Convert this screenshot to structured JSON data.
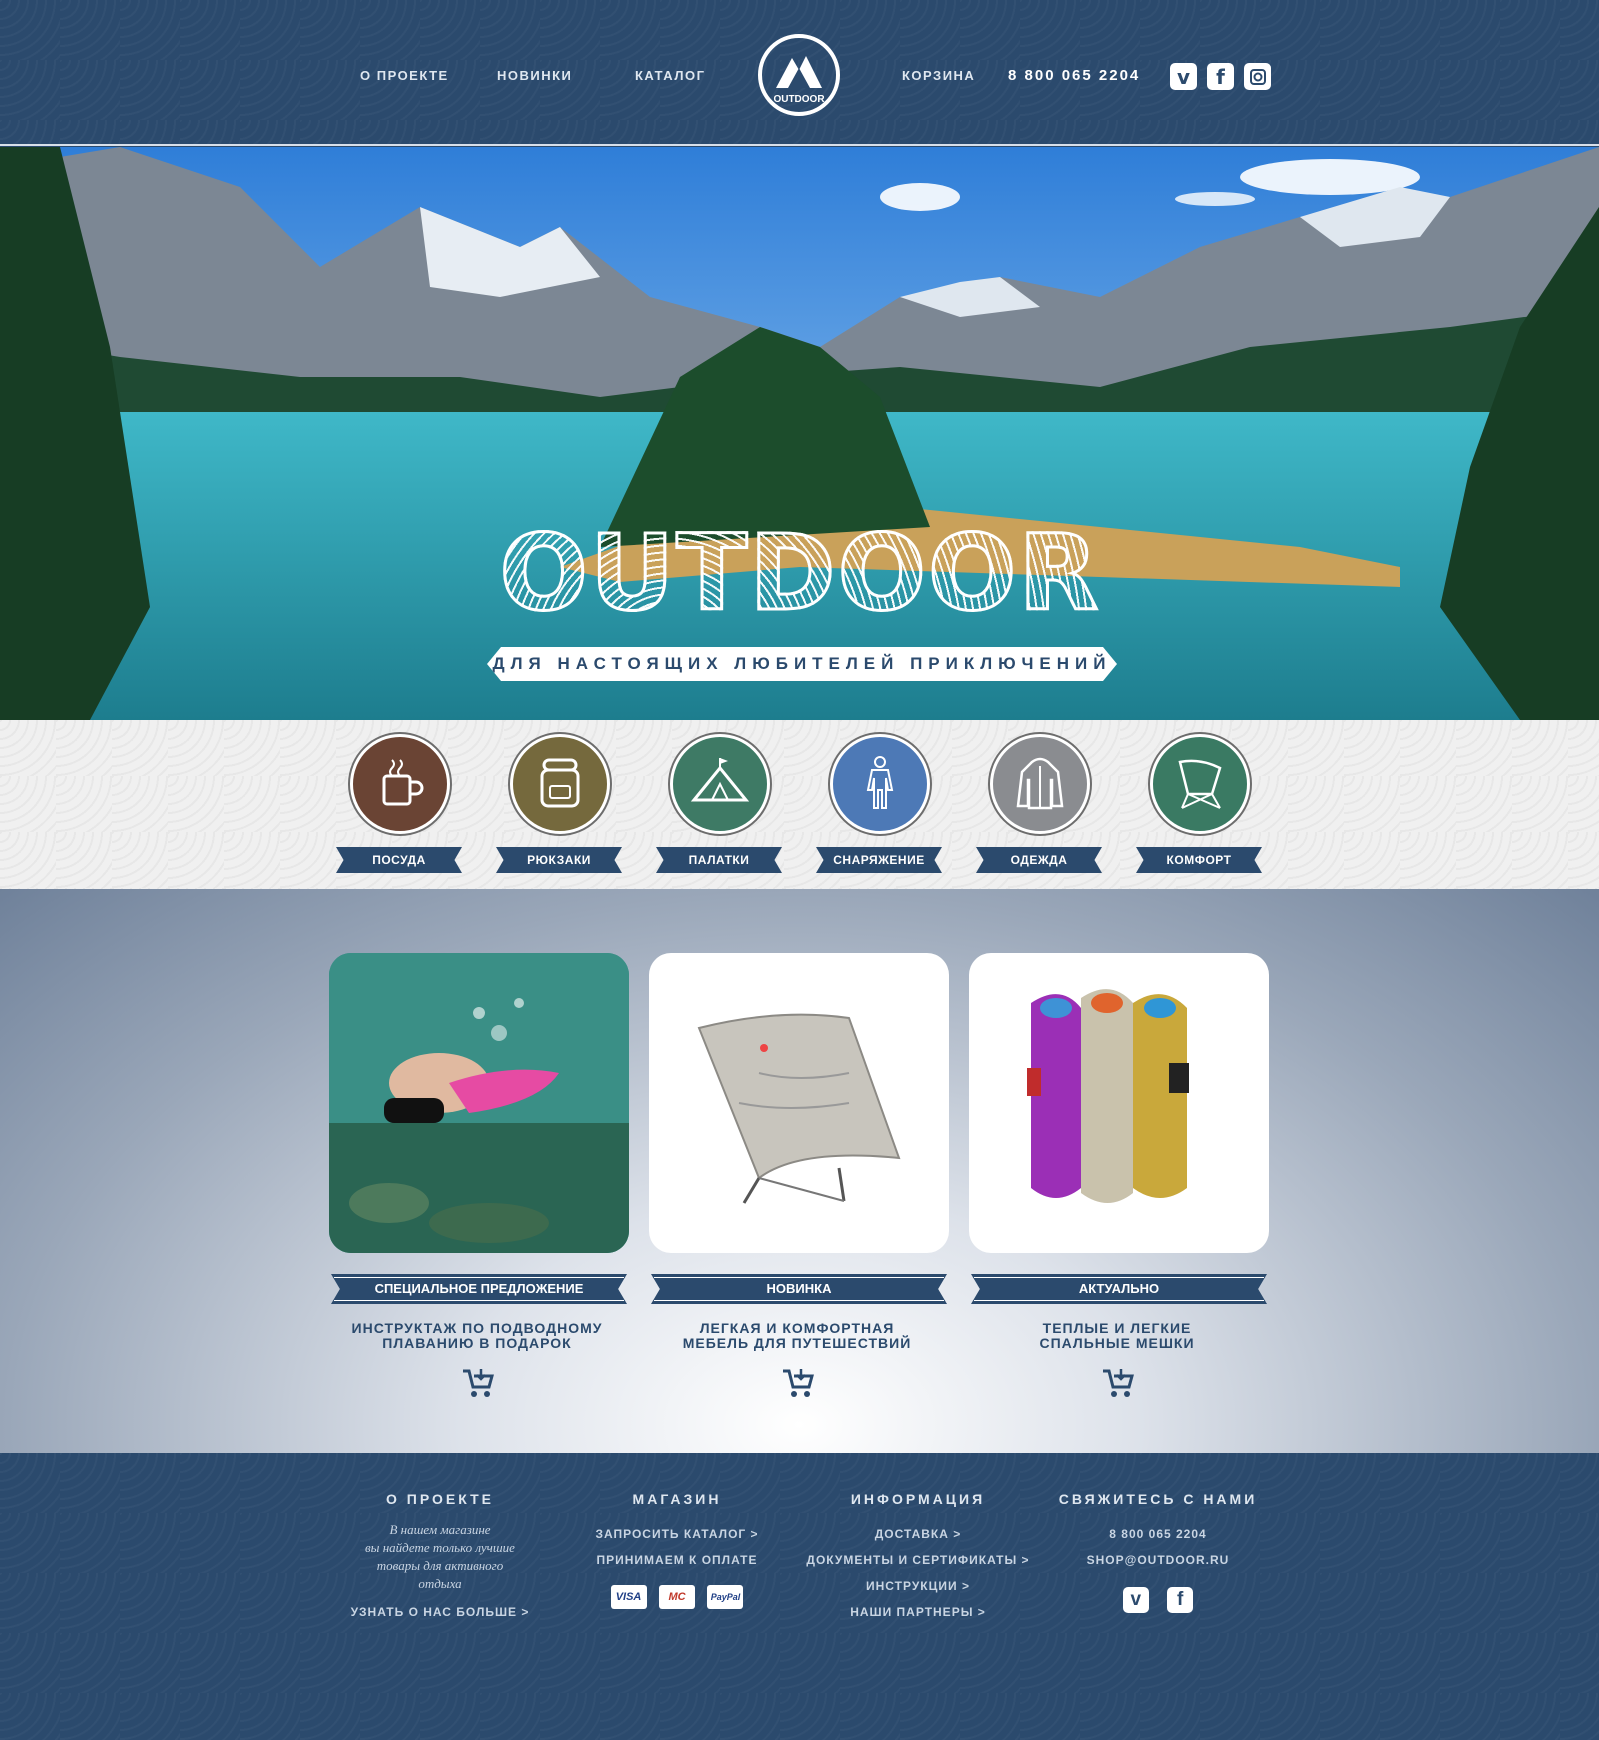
{
  "header": {
    "nav": [
      "О ПРОЕКТЕ",
      "НОВИНКИ",
      "КАТАЛОГ",
      "КОРЗИНА"
    ],
    "logo_text": "OUTDOOR",
    "phone": "8 800 065 2204",
    "social": [
      "vimeo-icon",
      "facebook-icon",
      "instagram-icon"
    ]
  },
  "hero": {
    "title": "OUTDOOR",
    "tagline": "ДЛЯ НАСТОЯЩИХ ЛЮБИТЕЛЕЙ ПРИКЛЮЧЕНИЙ"
  },
  "categories": [
    {
      "label": "ПОСУДА",
      "icon": "mug-icon",
      "color": "#6a4434"
    },
    {
      "label": "РЮКЗАКИ",
      "icon": "backpack-icon",
      "color": "#75693d"
    },
    {
      "label": "ПАЛАТКИ",
      "icon": "tent-icon",
      "color": "#3e7a65"
    },
    {
      "label": "СНАРЯЖЕНИЕ",
      "icon": "wetsuit-icon",
      "color": "#4d79b6"
    },
    {
      "label": "ОДЕЖДА",
      "icon": "jacket-icon",
      "color": "#8a8c90"
    },
    {
      "label": "КОМФОРТ",
      "icon": "chair-icon",
      "color": "#3a7a63"
    }
  ],
  "promos": [
    {
      "banner": "СПЕЦИАЛЬНОЕ ПРЕДЛОЖЕНИЕ",
      "line1": "ИНСТРУКТАЖ ПО ПОДВОДНОМУ",
      "line2": "ПЛАВАНИЮ В ПОДАРОК"
    },
    {
      "banner": "НОВИНКА",
      "line1": "ЛЕГКАЯ И КОМФОРТНАЯ",
      "line2": "МЕБЕЛЬ ДЛЯ ПУТЕШЕСТВИЙ"
    },
    {
      "banner": "АКТУАЛЬНО",
      "line1": "ТЕПЛЫЕ И ЛЕГКИЕ",
      "line2": "СПАЛЬНЫЕ МЕШКИ"
    }
  ],
  "footer": {
    "about": {
      "heading": "О ПРОЕКТЕ",
      "text1": "В нашем магазине",
      "text2": "вы найдете только лучшие",
      "text3": "товары для активного",
      "text4": "отдыха",
      "link": "УЗНАТЬ О НАС БОЛЬШЕ >"
    },
    "shop": {
      "heading": "МАГАЗИН",
      "link1": "ЗАПРОСИТЬ КАТАЛОГ >",
      "link2": "ПРИНИМАЕМ К ОПЛАТЕ",
      "pay1": "VISA",
      "pay2": "MC",
      "pay3": "PayPal"
    },
    "info": {
      "heading": "ИНФОРМАЦИЯ",
      "link1": "ДОСТАВКА >",
      "link2": "ДОКУМЕНТЫ И СЕРТИФИКАТЫ >",
      "link3": "ИНСТРУКЦИИ >",
      "link4": "НАШИ ПАРТНЕРЫ >"
    },
    "contact": {
      "heading": "СВЯЖИТЕСЬ С НАМИ",
      "phone": "8 800 065 2204",
      "email": "SHOP@OUTDOOR.RU"
    }
  },
  "colors": {
    "navy": "#2b4a6d",
    "light": "#f0f0f0"
  }
}
